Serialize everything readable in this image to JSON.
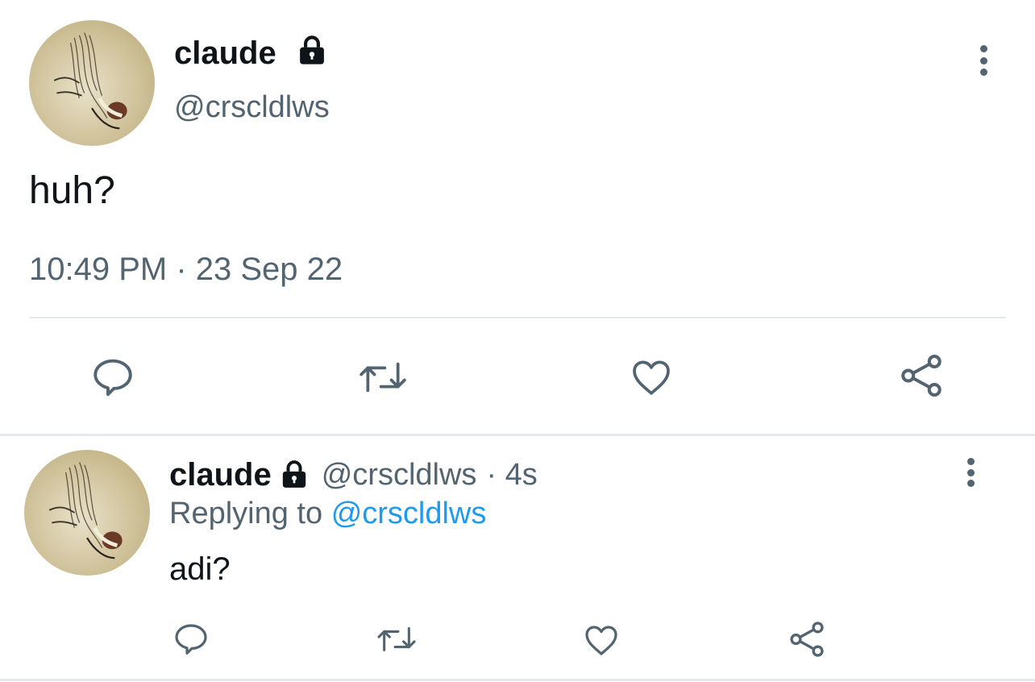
{
  "main_tweet": {
    "author": {
      "display_name": "claude",
      "handle": "@crscldlws",
      "locked": true
    },
    "text": "huh?",
    "timestamp": "10:49 PM · 23 Sep 22",
    "actions": [
      "reply-icon",
      "retweet-icon",
      "like-icon",
      "share-icon"
    ]
  },
  "reply": {
    "author": {
      "display_name": "claude",
      "handle": "@crscldlws",
      "locked": true
    },
    "time_ago": "· 4s",
    "replying_prefix": "Replying to",
    "replying_to": "@crscldlws",
    "text": "adi?",
    "actions": [
      "reply-icon",
      "retweet-icon",
      "like-icon",
      "share-icon"
    ]
  },
  "colors": {
    "text": "#0f1419",
    "muted": "#536471",
    "link": "#1d9bf0",
    "divider": "#e6e9eb"
  }
}
